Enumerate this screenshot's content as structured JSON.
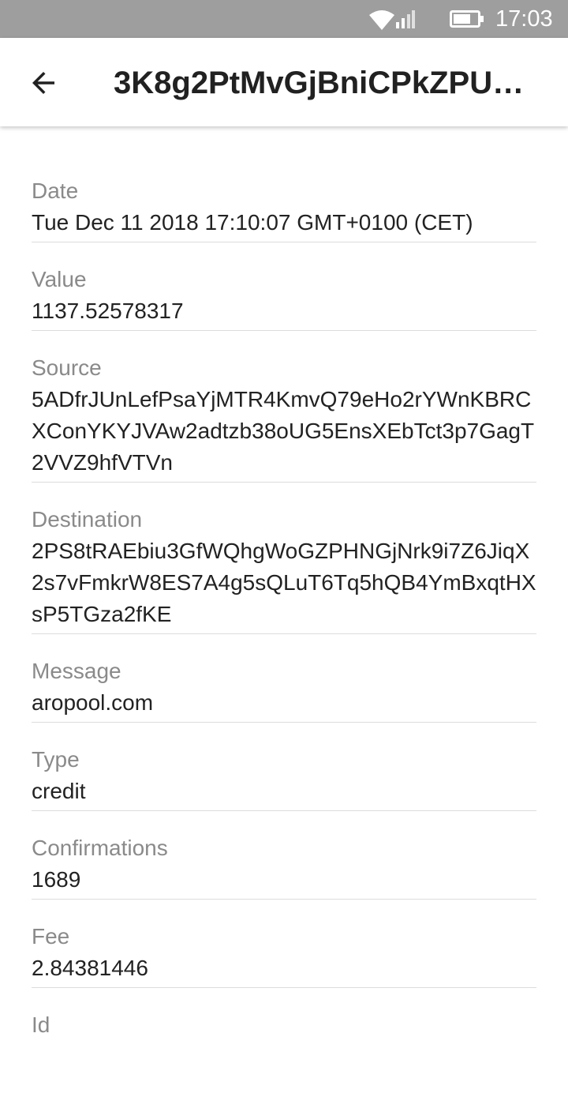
{
  "status_bar": {
    "time": "17:03",
    "icons": [
      "wifi-icon",
      "signal-icon",
      "battery-icon"
    ],
    "color": "#9e9e9e"
  },
  "app_bar": {
    "title": "3K8g2PtMvGjBniCPkZPU…",
    "back_icon": "arrow-back-icon"
  },
  "fields": [
    {
      "label": "Date",
      "value": "Tue Dec 11 2018 17:10:07 GMT+0100 (CET)"
    },
    {
      "label": "Value",
      "value": "1137.52578317"
    },
    {
      "label": "Source",
      "value": "5ADfrJUnLefPsaYjMTR4KmvQ79eHo2rYWnKBRCXConYKYJVAw2adtzb38oUG5EnsXEbTct3p7GagT2VVZ9hfVTVn"
    },
    {
      "label": "Destination",
      "value": "2PS8tRAEbiu3GfWQhgWoGZPHNGjNrk9i7Z6JiqX2s7vFmkrW8ES7A4g5sQLuT6Tq5hQB4YmBxqtHXsP5TGza2fKE"
    },
    {
      "label": "Message",
      "value": "aropool.com"
    },
    {
      "label": "Type",
      "value": "credit"
    },
    {
      "label": "Confirmations",
      "value": "1689"
    },
    {
      "label": "Fee",
      "value": "2.84381446"
    },
    {
      "label": "Id",
      "value": ""
    }
  ]
}
